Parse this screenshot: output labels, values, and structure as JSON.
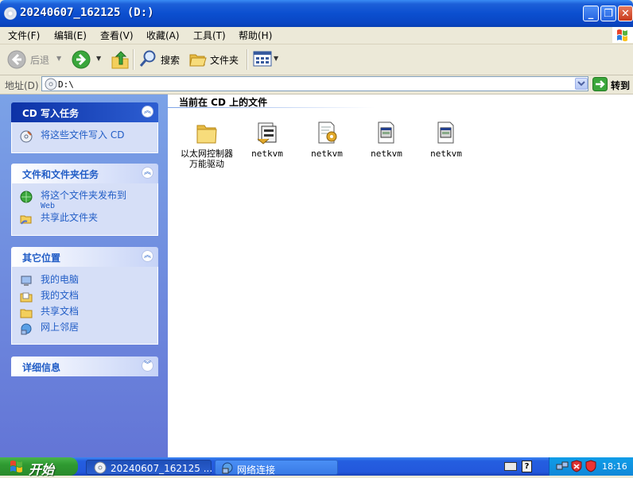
{
  "window": {
    "title": "20240607_162125 (D:)"
  },
  "menu": [
    "文件(F)",
    "编辑(E)",
    "查看(V)",
    "收藏(A)",
    "工具(T)",
    "帮助(H)"
  ],
  "toolbar": {
    "back": "后退",
    "search": "搜索",
    "folders": "文件夹"
  },
  "address": {
    "label": "地址(D)",
    "value": "D:\\",
    "go": "转到"
  },
  "panels": {
    "cd_tasks": {
      "title": "CD 写入任务",
      "items": [
        "将这些文件写入 CD"
      ]
    },
    "file_tasks": {
      "title": "文件和文件夹任务",
      "items": [
        "将这个文件夹发布到",
        "Web",
        "共享此文件夹"
      ]
    },
    "other_places": {
      "title": "其它位置",
      "items": [
        "我的电脑",
        "我的文档",
        "共享文档",
        "网上邻居"
      ]
    },
    "details": {
      "title": "详细信息"
    }
  },
  "content": {
    "heading": "当前在 CD 上的文件",
    "files": [
      {
        "name": "以太网控制器万能驱动",
        "icon": "folder-icon"
      },
      {
        "name": "netkvm",
        "icon": "catalog-file-icon"
      },
      {
        "name": "netkvm",
        "icon": "setup-info-file-icon"
      },
      {
        "name": "netkvm",
        "icon": "system-file-icon"
      },
      {
        "name": "netkvm",
        "icon": "system-file-icon"
      }
    ]
  },
  "taskbar": {
    "start": "开始",
    "tasks": [
      "20240607_162125 ...",
      "网络连接"
    ],
    "clock": "18:16"
  },
  "colors": {
    "titlebar": "#0a46c4",
    "taskpane": "#7ba2e7",
    "link": "#215dc6",
    "start": "#2f9a31"
  }
}
